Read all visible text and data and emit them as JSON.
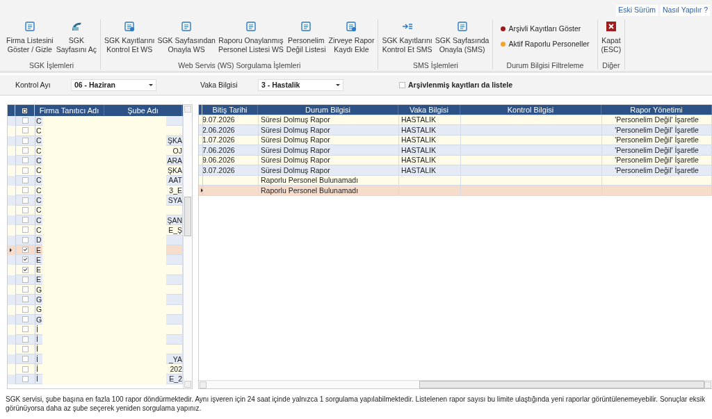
{
  "links": [
    "Eski Sürüm",
    "Nasıl Yapılır ?"
  ],
  "ribbon": [
    {
      "label": "SGK İşlemleri",
      "items": [
        {
          "kind": "button",
          "lines": [
            "Firma Listesini",
            "Göster / Gizle"
          ]
        },
        {
          "kind": "button",
          "lines": [
            "SGK",
            "Sayfasını Aç"
          ]
        }
      ]
    },
    {
      "label": "Web Servis (WS) Sorgulama İşlemleri",
      "items": [
        {
          "kind": "button",
          "lines": [
            "SGK Kayıtlarını",
            "Kontrol Et WS"
          ]
        },
        {
          "kind": "button",
          "lines": [
            "SGK Sayfasından",
            "Onayla WS"
          ]
        },
        {
          "kind": "button",
          "lines": [
            "Raporu Onaylanmış",
            "Personel Listesi WS"
          ]
        },
        {
          "kind": "button",
          "lines": [
            "Personelim",
            "Değil Listesi"
          ]
        },
        {
          "kind": "button",
          "lines": [
            "Zirveye Rapor",
            "Kaydı Ekle"
          ]
        }
      ]
    },
    {
      "label": "SMS İşlemleri",
      "items": [
        {
          "kind": "button",
          "lines": [
            "SGK Kayıtlarını",
            "Kontrol Et SMS"
          ]
        },
        {
          "kind": "button",
          "lines": [
            "SGK Sayfasında",
            "Onayla (SMS)"
          ]
        }
      ]
    },
    {
      "label": "Durum Bilgisi Filtreleme",
      "items": [
        {
          "kind": "legend",
          "color": "#9b1c1c",
          "text": "Arşivli Kayıtları Göster"
        },
        {
          "kind": "legend",
          "color": "#f5a033",
          "text": "Aktif Raporlu Personeller"
        }
      ]
    },
    {
      "label": "Diğer",
      "items": [
        {
          "kind": "button",
          "lines": [
            "Kapat",
            "(ESC)"
          ]
        }
      ]
    }
  ],
  "filters": {
    "kontrol_ayi": {
      "label": "Kontrol Ayı",
      "value": "06 - Haziran"
    },
    "vaka": {
      "label": "Vaka Bilgisi",
      "value": "3 - Hastalik"
    },
    "archive": {
      "label": "Arşivlenmiş kayıtları da listele",
      "checked": false
    }
  },
  "left_grid": {
    "header_checkbox": {
      "indeterminate": true
    },
    "columns": [
      "Firma Tanıtıcı Adı",
      "Şube Adı"
    ],
    "rows": [
      {
        "checked": false,
        "selected": false,
        "firma": "C"
      },
      {
        "checked": false,
        "selected": false,
        "firma": "C"
      },
      {
        "checked": false,
        "selected": false,
        "firma": "C",
        "sube": "ŞKA"
      },
      {
        "checked": false,
        "selected": false,
        "firma": "C",
        "sube": "OJ"
      },
      {
        "checked": false,
        "selected": false,
        "firma": "C",
        "sube": "ARA"
      },
      {
        "checked": false,
        "selected": false,
        "firma": "C",
        "sube": "ŞKA"
      },
      {
        "checked": false,
        "selected": false,
        "firma": "C",
        "sube": "AAT"
      },
      {
        "checked": false,
        "selected": false,
        "firma": "C",
        "sube": "3_E"
      },
      {
        "checked": false,
        "selected": false,
        "firma": "C",
        "sube": "SYA"
      },
      {
        "checked": false,
        "selected": false,
        "firma": "C"
      },
      {
        "checked": false,
        "selected": false,
        "firma": "C",
        "sube": "ŞAN"
      },
      {
        "checked": false,
        "selected": false,
        "firma": "C",
        "sube": "E_Ş"
      },
      {
        "checked": false,
        "selected": false,
        "firma": "D"
      },
      {
        "checked": true,
        "selected": true,
        "firma": "E"
      },
      {
        "checked": true,
        "selected": false,
        "firma": "E"
      },
      {
        "checked": true,
        "selected": false,
        "firma": "E"
      },
      {
        "checked": false,
        "selected": false,
        "firma": "E"
      },
      {
        "checked": false,
        "selected": false,
        "firma": "G"
      },
      {
        "checked": false,
        "selected": false,
        "firma": "G"
      },
      {
        "checked": false,
        "selected": false,
        "firma": "G"
      },
      {
        "checked": false,
        "selected": false,
        "firma": "G"
      },
      {
        "checked": false,
        "selected": false,
        "firma": "İ"
      },
      {
        "checked": false,
        "selected": false,
        "firma": "İ"
      },
      {
        "checked": false,
        "selected": false,
        "firma": "İ"
      },
      {
        "checked": false,
        "selected": false,
        "firma": "İ",
        "sube": "_YA"
      },
      {
        "checked": false,
        "selected": false,
        "firma": "İ",
        "sube": "202"
      },
      {
        "checked": false,
        "selected": false,
        "firma": "İ",
        "sube": "E_2"
      }
    ]
  },
  "right_grid": {
    "columns": [
      "Bitiş Tarihi",
      "Durum Bilgisi",
      "Vaka Bilgisi",
      "Kontrol Bilgisi",
      "Rapor Yönetimi"
    ],
    "rows": [
      {
        "selected": false,
        "bitis": "9.07.2026",
        "durum": "Süresi Dolmuş Rapor",
        "vaka": "HASTALIK",
        "rapor": "'Personelim Değil' İşaretle"
      },
      {
        "selected": false,
        "bitis": "2.06.2026",
        "durum": "Süresi Dolmuş Rapor",
        "vaka": "HASTALIK",
        "rapor": "'Personelim Değil' İşaretle"
      },
      {
        "selected": false,
        "bitis": "1.07.2026",
        "durum": "Süresi Dolmuş Rapor",
        "vaka": "HASTALIK",
        "rapor": "'Personelim Değil' İşaretle"
      },
      {
        "selected": false,
        "bitis": "7.06.2026",
        "durum": "Süresi Dolmuş Rapor",
        "vaka": "HASTALIK",
        "rapor": "'Personelim Değil' İşaretle"
      },
      {
        "selected": false,
        "bitis": "9.06.2026",
        "durum": "Süresi Dolmuş Rapor",
        "vaka": "HASTALIK",
        "rapor": "'Personelim Değil' İşaretle"
      },
      {
        "selected": false,
        "bitis": "3.07.2026",
        "durum": "Süresi Dolmuş Rapor",
        "vaka": "HASTALIK",
        "rapor": "'Personelim Değil' İşaretle"
      },
      {
        "selected": false,
        "durum": "Raporlu Personel Bulunamadı"
      },
      {
        "selected": true,
        "durum": "Raporlu Personel Bulunamadı"
      }
    ]
  },
  "footer": "SGK servisi, şube başına en fazla 100 rapor döndürmektedir. Aynı işveren için 24 saat içinde yalnızca 1 sorgulama yapılabilmektedir. Listelenen rapor sayısı bu limite ulaştığında yeni raporlar görüntülenemeyebilir. Sonuçlar eksik görünüyorsa daha az şube seçerek yeniden sorgulama yapınız."
}
